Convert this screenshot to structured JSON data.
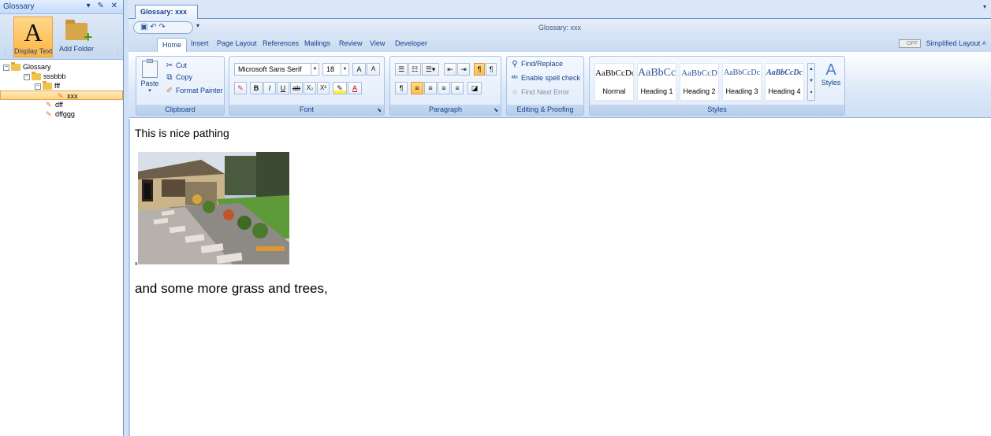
{
  "left_panel": {
    "title": "Glossary",
    "title_buttons": "▾ ✗ ✕",
    "toolbar": {
      "display_text_label": "Display Text",
      "add_folder_label": "Add Folder"
    },
    "tree": [
      {
        "label": "Glossary",
        "level": 0,
        "type": "folder",
        "expanded": true
      },
      {
        "label": "sssbbb",
        "level": 1,
        "type": "folder",
        "expanded": true
      },
      {
        "label": "fff",
        "level": 2,
        "type": "folder",
        "expanded": true
      },
      {
        "label": "xxx",
        "level": 3,
        "type": "item",
        "selected": true
      },
      {
        "label": "dff",
        "level": 3,
        "type": "item"
      },
      {
        "label": "dffggg",
        "level": 3,
        "type": "item"
      }
    ]
  },
  "doc_tab": {
    "label": "Glossary: xxx"
  },
  "window_title": "Glossary: xxx",
  "ribbon_tabs": [
    "Home",
    "Insert",
    "Page Layout",
    "References",
    "Mailings",
    "Review",
    "View",
    "Developer"
  ],
  "simplified_layout": {
    "toggle": "OFF",
    "label": "Simplified Layout"
  },
  "clipboard": {
    "paste": "Paste",
    "cut": "Cut",
    "copy": "Copy",
    "format_painter": "Format Painter",
    "caption": "Clipboard"
  },
  "font": {
    "family": "Microsoft Sans Serif",
    "size": "18",
    "caption": "Font"
  },
  "paragraph": {
    "caption": "Paragraph"
  },
  "editing": {
    "find_replace": "Find/Replace",
    "spell_check": "Enable spell check",
    "find_next_error": "Find Next Error",
    "caption": "Editing & Proofing"
  },
  "styles": {
    "items": [
      {
        "sample": "AaBbCcDc",
        "name": "Normal"
      },
      {
        "sample": "AaBbCcI",
        "name": "Heading 1"
      },
      {
        "sample": "AaBbCcD",
        "name": "Heading 2"
      },
      {
        "sample": "AaBbCcDc",
        "name": "Heading 3"
      },
      {
        "sample": "AaBbCcDc",
        "name": "Heading 4"
      }
    ],
    "styles_button": "Styles",
    "caption": "Styles"
  },
  "document": {
    "line1": "This is nice pathing",
    "image_marker": "x",
    "line2": "and some more grass and trees,"
  },
  "colors": {
    "accent": "#6593cf",
    "selection": "#ffd38a",
    "text_primary": "#15428b"
  }
}
